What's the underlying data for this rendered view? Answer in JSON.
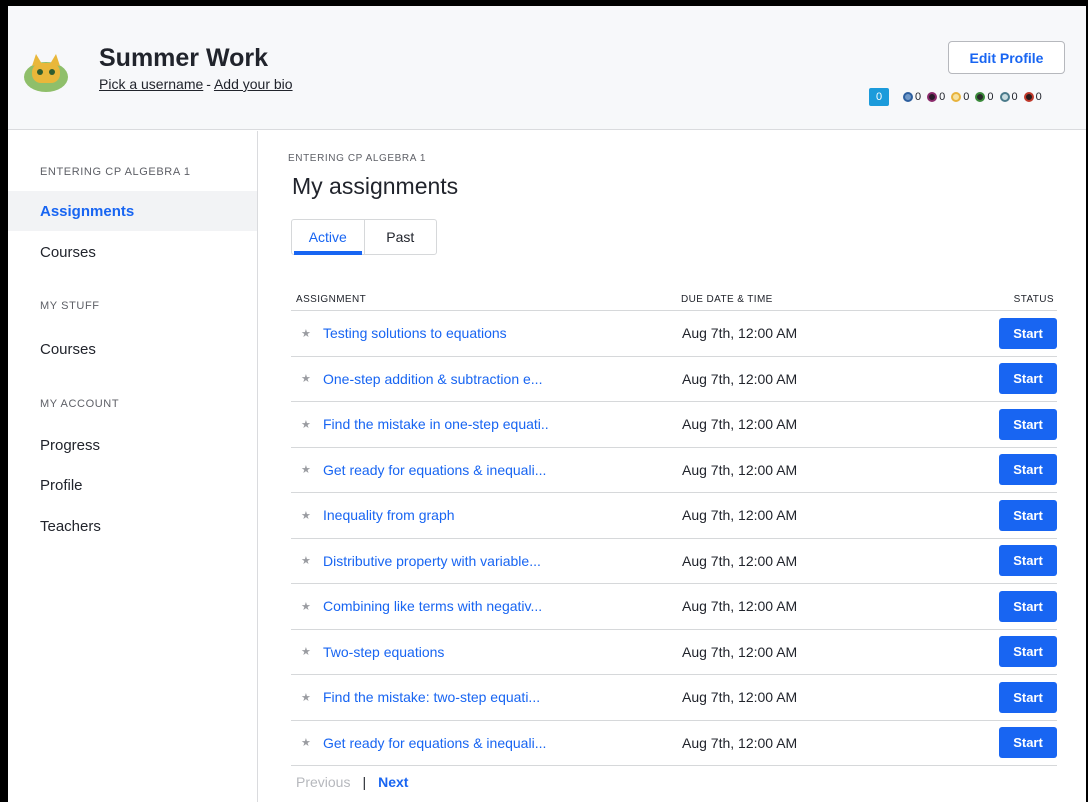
{
  "header": {
    "title": "Summer Work",
    "username_link": "Pick a username",
    "separator": "-",
    "bio_link": "Add your bio",
    "edit_button": "Edit Profile",
    "energy_points": "0",
    "badge_counts": [
      "0",
      "0",
      "0",
      "0",
      "0",
      "0"
    ],
    "badge_colors": [
      "#2d5f9e",
      "#8b2a6b",
      "#e8b33c",
      "#3a8a3a",
      "#4a7a8a",
      "#c0392b"
    ]
  },
  "sidebar": {
    "section1": "ENTERING CP ALGEBRA 1",
    "item_assignments": "Assignments",
    "item_courses1": "Courses",
    "section2": "MY STUFF",
    "item_courses2": "Courses",
    "section3": "MY ACCOUNT",
    "item_progress": "Progress",
    "item_profile": "Profile",
    "item_teachers": "Teachers"
  },
  "main": {
    "breadcrumb": "ENTERING CP ALGEBRA 1",
    "heading": "My assignments",
    "tab_active": "Active",
    "tab_past": "Past",
    "col_assignment": "ASSIGNMENT",
    "col_due": "DUE DATE & TIME",
    "col_status": "STATUS",
    "rows": [
      {
        "title": "Testing solutions to equations",
        "due": "Aug 7th, 12:00 AM",
        "status": "Start"
      },
      {
        "title": "One-step addition & subtraction e...",
        "due": "Aug 7th, 12:00 AM",
        "status": "Start"
      },
      {
        "title": "Find the mistake in one-step equati..",
        "due": "Aug 7th, 12:00 AM",
        "status": "Start"
      },
      {
        "title": "Get ready for equations & inequali...",
        "due": "Aug 7th, 12:00 AM",
        "status": "Start"
      },
      {
        "title": "Inequality from graph",
        "due": "Aug 7th, 12:00 AM",
        "status": "Start"
      },
      {
        "title": "Distributive property with variable...",
        "due": "Aug 7th, 12:00 AM",
        "status": "Start"
      },
      {
        "title": "Combining like terms with negativ...",
        "due": "Aug 7th, 12:00 AM",
        "status": "Start"
      },
      {
        "title": "Two-step equations",
        "due": "Aug 7th, 12:00 AM",
        "status": "Start"
      },
      {
        "title": "Find the mistake: two-step equati...",
        "due": "Aug 7th, 12:00 AM",
        "status": "Start"
      },
      {
        "title": "Get ready for equations & inequali...",
        "due": "Aug 7th, 12:00 AM",
        "status": "Start"
      }
    ],
    "pager_prev": "Previous",
    "pager_sep": "|",
    "pager_next": "Next"
  }
}
